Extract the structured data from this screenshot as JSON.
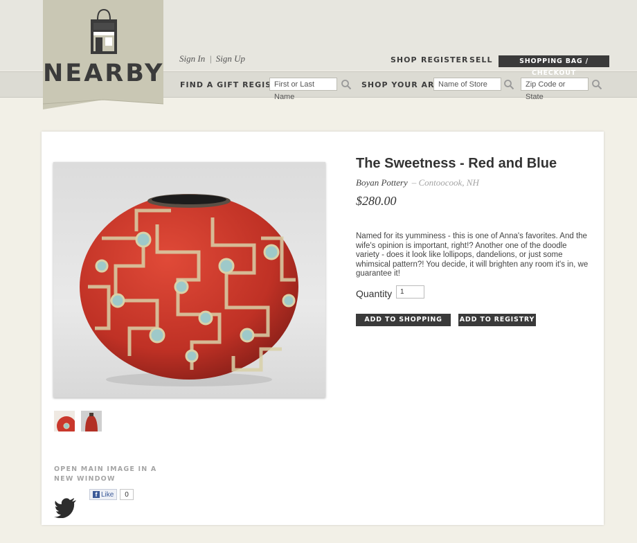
{
  "brand": {
    "name": "NEARBY"
  },
  "auth": {
    "sign_in": "Sign In",
    "separator": "|",
    "sign_up": "Sign Up"
  },
  "topnav": {
    "shop": "SHOP",
    "register": "REGISTER",
    "sell": "SELL",
    "checkout": "SHOPPING BAG / CHECKOUT"
  },
  "search": {
    "registry_label": "FIND A GIFT REGISTRY",
    "registry_placeholder": "First or Last Name",
    "area_label": "SHOP YOUR AREA",
    "store_placeholder": "Name of Store",
    "zip_placeholder": "Zip Code or State"
  },
  "product": {
    "title": "The Sweetness - Red and Blue",
    "maker": "Boyan Pottery",
    "location": "– Contoocook, NH",
    "price": "$280.00",
    "description": "Named for its yumminess - this is one of Anna's favorites. And the wife's opinion is important, right!?  Another one of the doodle variety - does it look like lollipops, dandelions, or just some whimsical pattern?!  You decide, it will brighten any room it's in, we guarantee it!",
    "quantity_label": "Quantity",
    "quantity_value": "1",
    "add_to_bag": "ADD TO SHOPPING BAG",
    "add_to_registry": "ADD TO REGISTRY",
    "open_image_link": "OPEN MAIN IMAGE IN A NEW WINDOW"
  },
  "social": {
    "like_label": "Like",
    "like_count": "0"
  },
  "icons": [
    "shopping-bag-icon",
    "search-icon",
    "twitter-icon",
    "facebook-icon"
  ],
  "colors": {
    "button_dark": "#3a3a3a",
    "vase_red": "#c9382c",
    "background": "#f2f0e7"
  }
}
